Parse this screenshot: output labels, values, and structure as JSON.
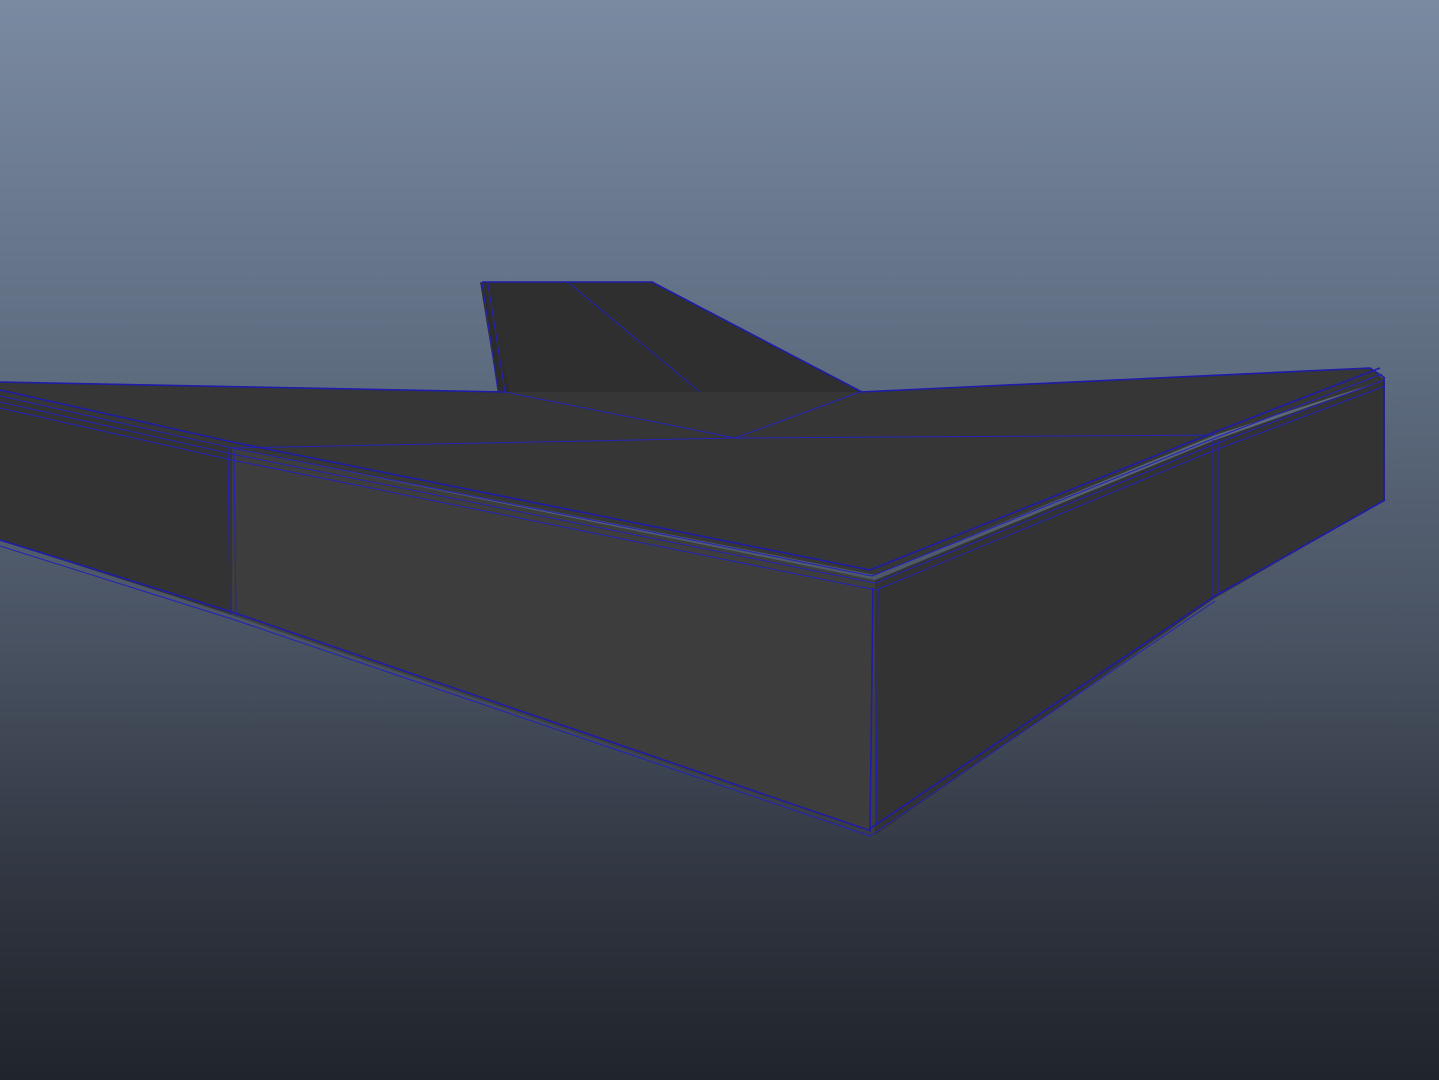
{
  "viewport": {
    "background_top": "#7a8aa1",
    "background_bottom": "#20242b",
    "mesh_fill": "#363636",
    "wireframe_color": "#1e1ca8"
  },
  "model": {
    "shading": "smooth-shaded-with-wireframe"
  }
}
